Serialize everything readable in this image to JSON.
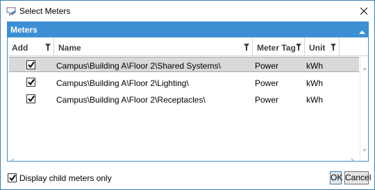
{
  "window": {
    "title": "Select Meters"
  },
  "group": {
    "title": "Meters"
  },
  "columns": {
    "add": "Add",
    "name": "Name",
    "meter_tag": "Meter Tag",
    "unit": "Unit"
  },
  "rows": [
    {
      "checked": true,
      "name": "Campus\\Building A\\Floor 2\\Shared Systems\\",
      "tag": "Power",
      "unit": "kWh",
      "selected": true
    },
    {
      "checked": true,
      "name": "Campus\\Building A\\Floor 2\\Lighting\\",
      "tag": "Power",
      "unit": "kWh",
      "selected": false
    },
    {
      "checked": true,
      "name": "Campus\\Building A\\Floor 2\\Receptacles\\",
      "tag": "Power",
      "unit": "kWh",
      "selected": false
    }
  ],
  "footer": {
    "child_only_label": "Display child meters only",
    "child_only_checked": true,
    "ok_label": "OK",
    "cancel_label": "Cancel"
  },
  "colors": {
    "accent": "#3d8fd4",
    "selection": "#d9d9d9"
  }
}
